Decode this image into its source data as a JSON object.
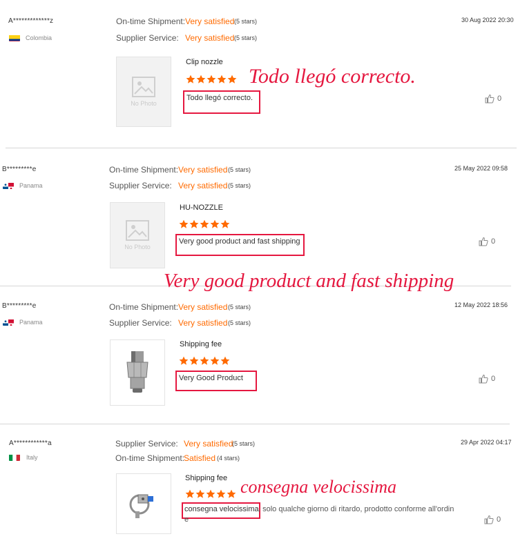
{
  "reviews": [
    {
      "username": "A*************z",
      "country": "Colombia",
      "flag": "colombia",
      "attributes": [
        {
          "label": "On-time Shipment:",
          "value": "Very satisfied",
          "stars": "(5 stars)"
        },
        {
          "label": "Supplier Service:",
          "value": "Very satisfied",
          "stars": "(5 stars)"
        }
      ],
      "date": "30 Aug 2022 20:30",
      "product": "Clip nozzle",
      "rating": 5,
      "text": "Todo llegó correcto.",
      "text_rest": "",
      "text_rest2": "",
      "helpful_count": "0",
      "image": {
        "kind": "no-photo",
        "label": "No Photo"
      }
    },
    {
      "username": "B*********e",
      "country": "Panama",
      "flag": "panama",
      "attributes": [
        {
          "label": "On-time Shipment:",
          "value": "Very satisfied",
          "stars": "(5 stars)"
        },
        {
          "label": "Supplier Service:",
          "value": "Very satisfied",
          "stars": "(5 stars)"
        }
      ],
      "date": "25 May 2022 09:58",
      "product": "HU-NOZZLE",
      "rating": 5,
      "text": "Very good product and fast shipping",
      "text_rest": "",
      "text_rest2": "",
      "helpful_count": "0",
      "image": {
        "kind": "no-photo",
        "label": "No Photo"
      }
    },
    {
      "username": "B*********e",
      "country": "Panama",
      "flag": "panama",
      "attributes": [
        {
          "label": "On-time Shipment:",
          "value": "Very satisfied",
          "stars": "(5 stars)"
        },
        {
          "label": "Supplier Service:",
          "value": "Very satisfied",
          "stars": "(5 stars)"
        }
      ],
      "date": "12 May 2022 18:56",
      "product": "Shipping fee",
      "rating": 5,
      "text": "Very Good Product",
      "text_rest": "",
      "text_rest2": "",
      "helpful_count": "0",
      "image": {
        "kind": "nozzle-photo",
        "label": ""
      }
    },
    {
      "username": "A************a",
      "country": "Italy",
      "flag": "italy",
      "attributes": [
        {
          "label": "Supplier Service:",
          "value": "Very satisfied",
          "stars": "(5 stars)"
        },
        {
          "label": "On-time Shipment:",
          "value": "Satisfied",
          "stars": "(4 stars)"
        }
      ],
      "date": "29 Apr 2022 04:17",
      "product": "Shipping fee",
      "rating": 5,
      "text": "consegna velocissima",
      "text_rest": ", solo qualche giorno di ritardo, prodotto conforme all'ordin",
      "text_rest2": "e",
      "helpful_count": "0",
      "image": {
        "kind": "clip-photo",
        "label": ""
      }
    }
  ],
  "annotations": [
    "Todo llegó correcto.",
    "Very good product and fast shipping",
    "consegna velocissima"
  ],
  "colors": {
    "accent": "#ff6a00",
    "annotation": "#e5173f",
    "divider": "#d6d6d6"
  }
}
